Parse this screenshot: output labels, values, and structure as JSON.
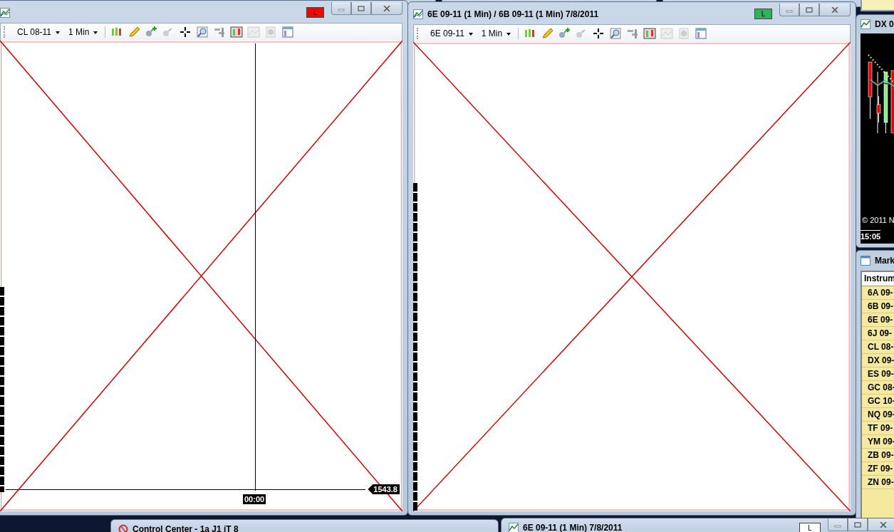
{
  "chart_windows": [
    {
      "link": {
        "label": "L",
        "color": "#ff0000"
      },
      "toolbar": {
        "instrument": "CL 08-11",
        "interval": "1 Min"
      },
      "time_label": "00:00",
      "price_label": "1543.8"
    },
    {
      "title": "6E 09-11 (1 Min) / 6B 09-11 (1 Min)  7/8/2011",
      "link": {
        "label": "L",
        "color": "#2fb35a"
      },
      "toolbar": {
        "instrument": "6E 09-11",
        "interval": "1 Min"
      }
    }
  ],
  "dx_window": {
    "title": "DX 0",
    "copyright": "© 2011 N",
    "time": "15:05"
  },
  "market_window": {
    "title": "Mark",
    "column": "Instrum",
    "rows": [
      "6A 09-",
      "6B 09-",
      "6E 09-",
      "6J 09-",
      "CL 08-",
      "DX 09-",
      "ES 09-",
      "GC 08-",
      "GC 10-",
      "NQ 09-",
      "TF 09-",
      "YM 09-",
      "ZB 09-",
      "ZF 09-",
      "ZN 09-"
    ]
  },
  "minimized_windows": [
    {
      "title": "Control Center - 1a J1 iT 8"
    },
    {
      "title": "6E 09-11 (1 Min)  7/8/2011",
      "link": {
        "label": "L",
        "color": "#ffffff"
      }
    }
  ]
}
